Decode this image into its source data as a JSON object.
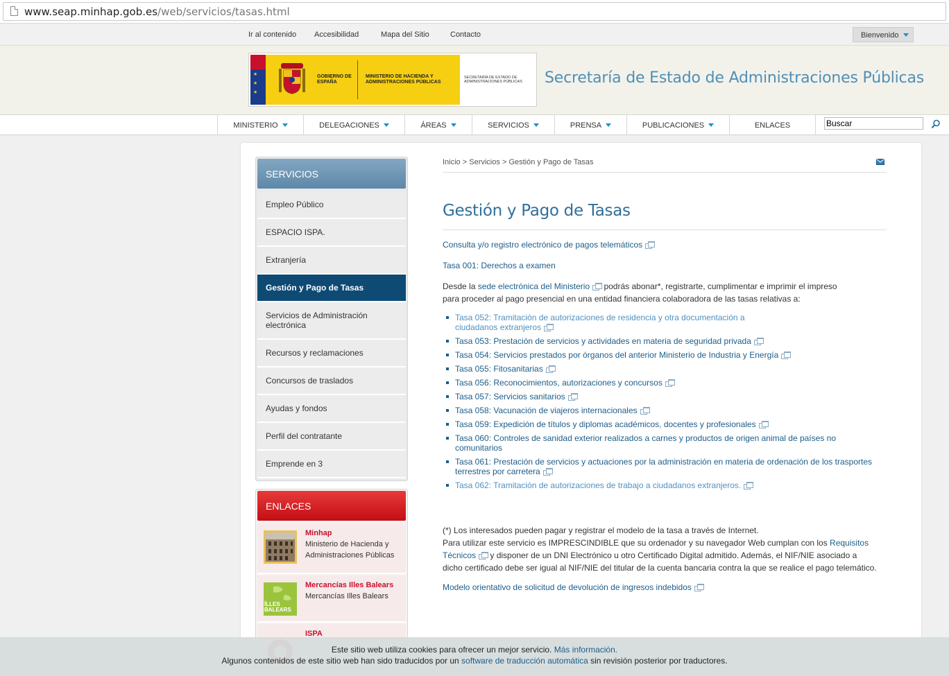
{
  "browser": {
    "url_host": "www.seap.minhap.gob.es",
    "url_path": "/web/servicios/tasas.html"
  },
  "utility_nav": [
    "Ir al contenido",
    "Accesibilidad",
    "Mapa del Sitio",
    "Contacto"
  ],
  "welcome_label": "Bienvenido",
  "header": {
    "logo_gobierno": "GOBIERNO DE ESPAÑA",
    "logo_ministerio": "MINISTERIO DE HACIENDA Y ADMINISTRACIONES PÚBLICAS",
    "logo_secretaria": "SECRETARÍA DE ESTADO DE ADMINISTRACIONES PÚBLICAS",
    "site_title": "Secretaría de Estado de Administraciones Públicas"
  },
  "main_nav": [
    {
      "label": "MINISTERIO",
      "dropdown": true
    },
    {
      "label": "DELEGACIONES",
      "dropdown": true
    },
    {
      "label": "ÁREAS",
      "dropdown": true
    },
    {
      "label": "SERVICIOS",
      "dropdown": true
    },
    {
      "label": "PRENSA",
      "dropdown": true
    },
    {
      "label": "PUBLICACIONES",
      "dropdown": true
    },
    {
      "label": "ENLACES",
      "dropdown": false
    }
  ],
  "search": {
    "value": "Buscar"
  },
  "sidebar": {
    "title": "SERVICIOS",
    "items": [
      {
        "label": "Empleo Público"
      },
      {
        "label": "ESPACIO ISPA."
      },
      {
        "label": "Extranjería"
      },
      {
        "label": "Gestión y Pago de Tasas",
        "active": true
      },
      {
        "label": "Servicios de Administración electrónica"
      },
      {
        "label": "Recursos y reclamaciones"
      },
      {
        "label": "Concursos de traslados"
      },
      {
        "label": "Ayudas y fondos"
      },
      {
        "label": "Perfil del contratante"
      },
      {
        "label": "Emprende en 3"
      }
    ]
  },
  "enlaces": {
    "title": "ENLACES",
    "items": [
      {
        "title": "Minhap",
        "desc": "Ministerio de Hacienda y Administraciones Públicas"
      },
      {
        "title": "Mercancías Illes Balears",
        "desc": "Mercancías Illes Balears",
        "thumb_text": "ÍLLES BALEARS"
      },
      {
        "title": "ISPA",
        "desc": ""
      }
    ]
  },
  "breadcrumb": {
    "items": [
      "Inicio",
      "Servicios",
      "Gestión y Pago de Tasas"
    ],
    "sep": ">"
  },
  "content": {
    "title": "Gestión y Pago de Tasas",
    "link_consulta": "Consulta y/o registro electrónico de pagos telemáticos",
    "link_tasa001": "Tasa 001: Derechos a examen",
    "intro_a": "Desde la ",
    "intro_link": "sede electrónica del Ministerio",
    "intro_b": " podrás abonar*, registrarte, cumplimentar e imprimir el impreso",
    "intro_c": "para proceder al pago presencial en una entidad financiera colaboradora de las tasas relativas a:",
    "tasas": [
      {
        "label": "Tasa 052: Tramitación de autorizaciones de residencia y otra documentación a ciudadanos extranjeros",
        "light": true
      },
      {
        "label": "Tasa 053: Prestación de servicios y actividades en materia de seguridad privada"
      },
      {
        "label": "Tasa 054: Servicios prestados por órganos del anterior Ministerio de Industria y Energía"
      },
      {
        "label": "Tasa 055: Fitosanitarias"
      },
      {
        "label": "Tasa 056: Reconocimientos, autorizaciones y concursos"
      },
      {
        "label": "Tasa 057: Servicios sanitarios"
      },
      {
        "label": "Tasa 058: Vacunación de viajeros internacionales"
      },
      {
        "label": "Tasa 059: Expedición de títulos y diplomas académicos, docentes y profesionales"
      },
      {
        "label": "Tasa 060: Controles de sanidad exterior realizados a carnes y productos de origen animal de países no comunitarios"
      },
      {
        "label": "Tasa 061: Prestación de servicios y actuaciones por la administración en materia de ordenación de los trasportes terrestres por carretera"
      },
      {
        "label": "Tasa 062: Tramitación de autorizaciones de trabajo a ciudadanos extranjeros.",
        "light": true
      }
    ],
    "note_1": "(*) Los interesados pueden pagar y registrar el modelo de la tasa a través de Internet.",
    "note_2a": "Para utilizar este servicio es IMPRESCINDIBLE que su ordenador y su navegador Web cumplan con los ",
    "note_2_link1": "Requisitos",
    "note_2_link2": "Técnicos",
    "note_2b": " y disponer de un DNI Electrónico u otro Certificado Digital admitido. Además, el NIF/NIE asociado a",
    "note_2c": "dicho certificado debe ser igual al NIF/NIE del titular de la cuenta bancaria contra la que se realice el pago telemático.",
    "link_modelo": "Modelo orientativo de solicitud de devolución de ingresos indebidos"
  },
  "cookie": {
    "line1": "Este sitio web utiliza cookies para ofrecer un mejor servicio. ",
    "line1_link": "Más información.",
    "line2a": "Algunos contenidos de este sitio web han sido traducidos por un ",
    "line2_link": "software de traducción automática",
    "line2b": " sin revisión posterior por traductores."
  },
  "colors": {
    "accent": "#1b5d8a",
    "sidebar_active": "#0e4a73",
    "enlaces_red": "#c50d14",
    "title_blue": "#4f8fb7"
  }
}
